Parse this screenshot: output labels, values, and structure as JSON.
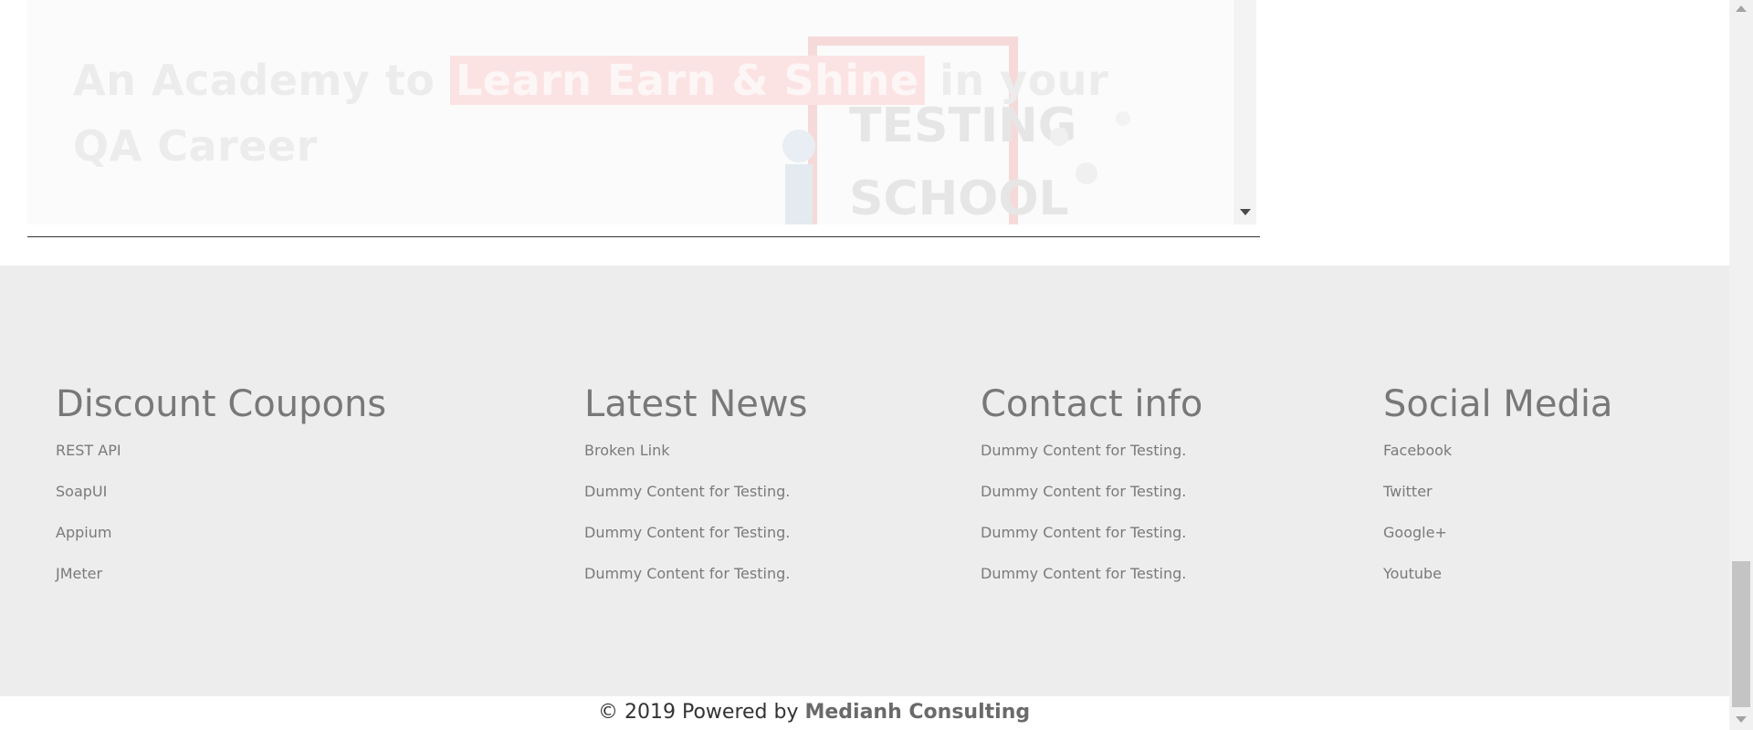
{
  "hero": {
    "title_part1": "An Academy to ",
    "title_highlight": "Learn Earn & Shine",
    "title_part2": "  in your QA Career"
  },
  "footer": {
    "columns": [
      {
        "heading": "Discount Coupons",
        "items": [
          "REST API",
          "SoapUI",
          "Appium",
          "JMeter"
        ]
      },
      {
        "heading": "Latest News",
        "items": [
          "Broken Link",
          "Dummy Content for Testing.",
          "Dummy Content for Testing.",
          "Dummy Content for Testing."
        ]
      },
      {
        "heading": "Contact info",
        "items": [
          "Dummy Content for Testing.",
          "Dummy Content for Testing.",
          "Dummy Content for Testing.",
          "Dummy Content for Testing."
        ]
      },
      {
        "heading": "Social Media",
        "items": [
          "Facebook",
          "Twitter",
          "Google+",
          "Youtube"
        ]
      }
    ]
  },
  "copyright": {
    "prefix": "© 2019 Powered by ",
    "brand": "Medianh Consulting"
  },
  "colors": {
    "footer_bg": "#ededed",
    "heading": "#787878",
    "link": "#7a7a7a",
    "highlight": "#fce3e3"
  }
}
